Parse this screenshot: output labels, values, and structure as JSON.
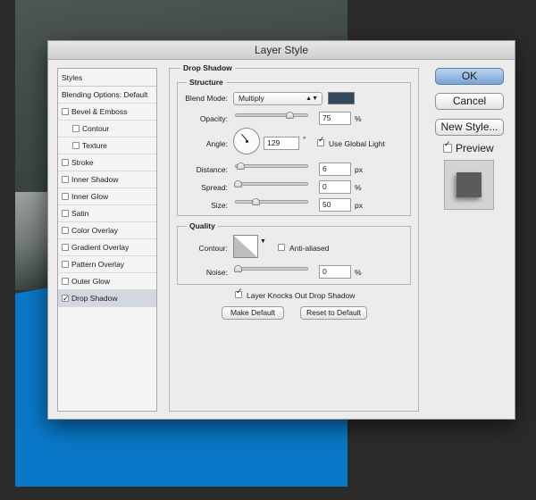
{
  "dialog": {
    "title": "Layer Style"
  },
  "styles_list": {
    "header": "Styles",
    "blending_options": "Blending Options: Default",
    "items": [
      {
        "label": "Bevel & Emboss",
        "checked": false
      },
      {
        "label": "Contour",
        "checked": false
      },
      {
        "label": "Texture",
        "checked": false
      },
      {
        "label": "Stroke",
        "checked": false
      },
      {
        "label": "Inner Shadow",
        "checked": false
      },
      {
        "label": "Inner Glow",
        "checked": false
      },
      {
        "label": "Satin",
        "checked": false
      },
      {
        "label": "Color Overlay",
        "checked": false
      },
      {
        "label": "Gradient Overlay",
        "checked": false
      },
      {
        "label": "Pattern Overlay",
        "checked": false
      },
      {
        "label": "Outer Glow",
        "checked": false
      },
      {
        "label": "Drop Shadow",
        "checked": true
      }
    ]
  },
  "drop_shadow": {
    "title": "Drop Shadow",
    "structure": {
      "title": "Structure",
      "blend_mode_label": "Blend Mode:",
      "blend_mode_value": "Multiply",
      "shadow_color": "#34485e",
      "opacity_label": "Opacity:",
      "opacity_value": "75",
      "opacity_unit": "%",
      "angle_label": "Angle:",
      "angle_value": "129",
      "angle_unit": "°",
      "use_global_light_label": "Use Global Light",
      "use_global_light_checked": true,
      "distance_label": "Distance:",
      "distance_value": "6",
      "distance_unit": "px",
      "spread_label": "Spread:",
      "spread_value": "0",
      "spread_unit": "%",
      "size_label": "Size:",
      "size_value": "50",
      "size_unit": "px"
    },
    "quality": {
      "title": "Quality",
      "contour_label": "Contour:",
      "anti_aliased_label": "Anti-aliased",
      "anti_aliased_checked": false,
      "noise_label": "Noise:",
      "noise_value": "0",
      "noise_unit": "%"
    },
    "knocks_out_label": "Layer Knocks Out Drop Shadow",
    "knocks_out_checked": true,
    "make_default_label": "Make Default",
    "reset_default_label": "Reset to Default"
  },
  "buttons": {
    "ok": "OK",
    "cancel": "Cancel",
    "new_style": "New Style...",
    "preview_label": "Preview",
    "preview_checked": true
  },
  "colors": {
    "canvas_blue": "#0a78c8",
    "shadow_color": "#34485e",
    "selected_item_bg": "#d3d8e0"
  }
}
